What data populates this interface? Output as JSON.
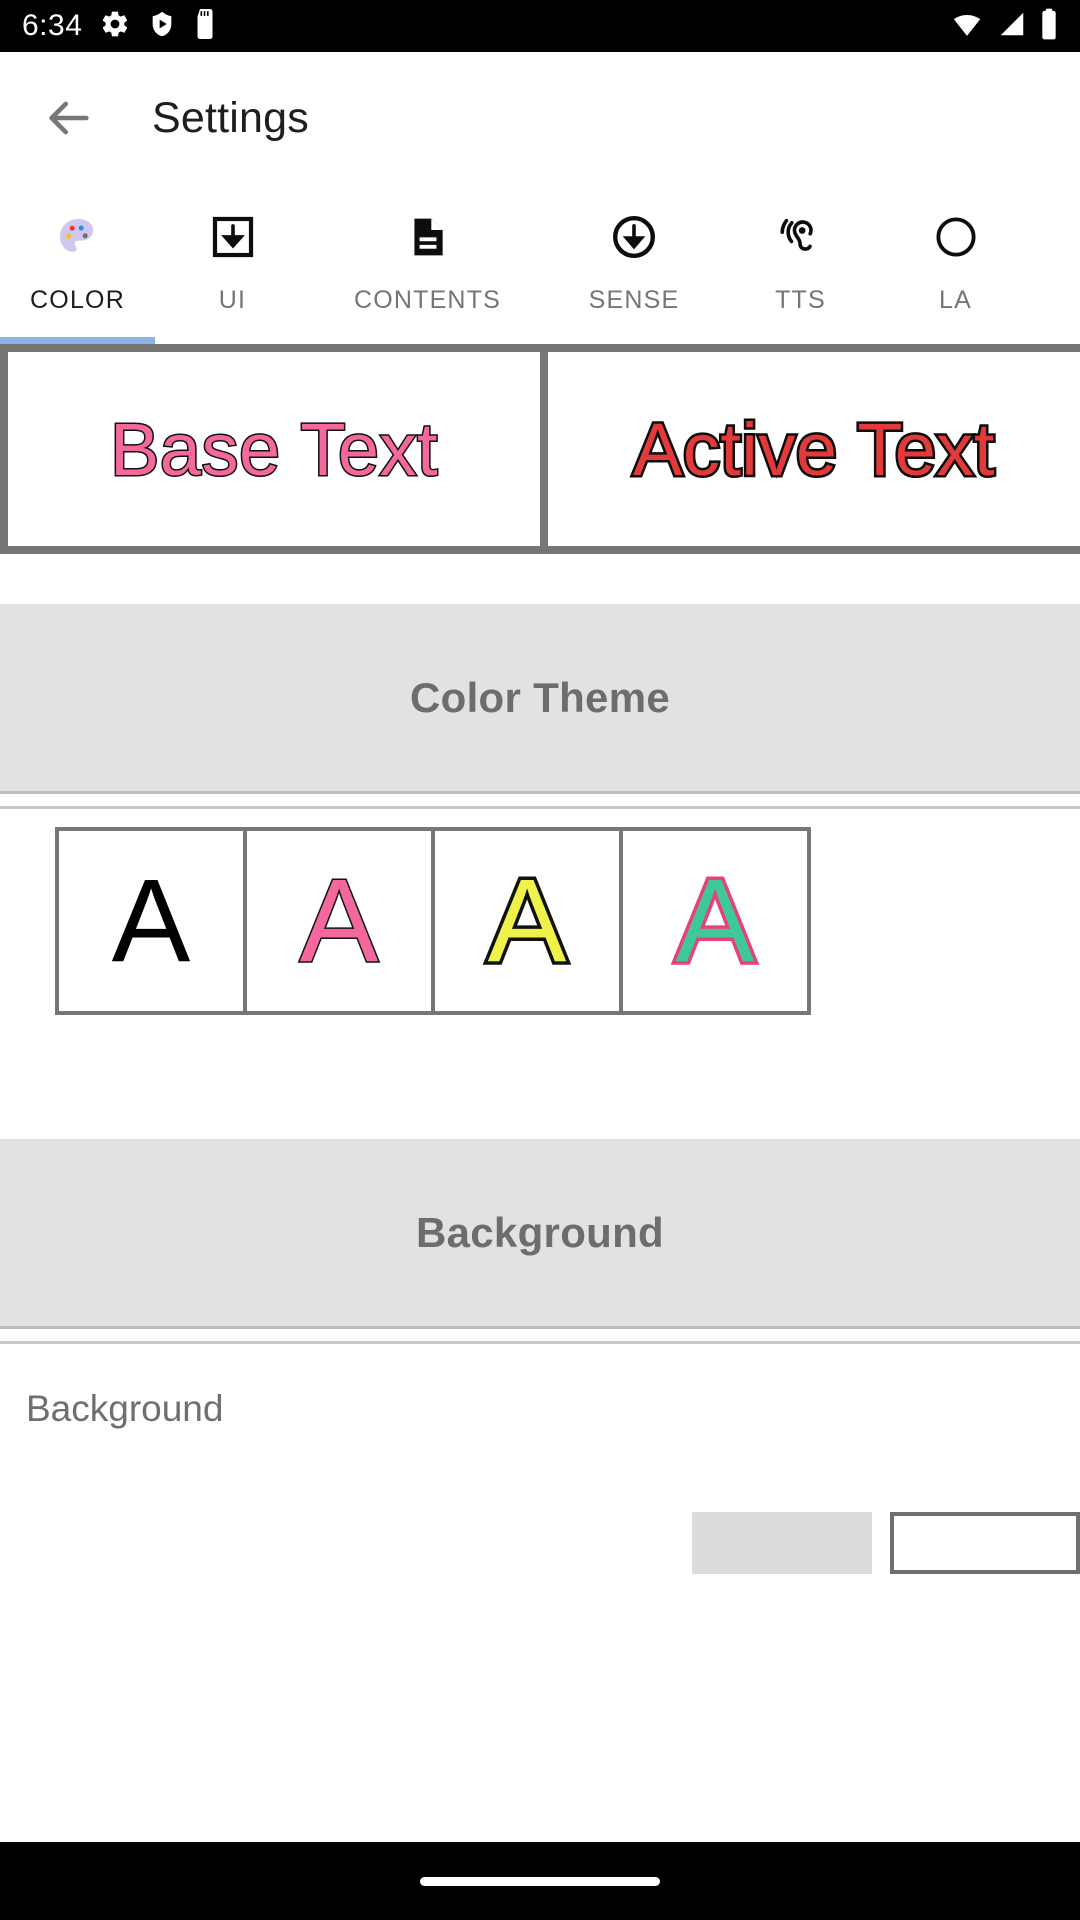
{
  "status_bar": {
    "time": "6:34",
    "left_icons": [
      "gear-icon",
      "shield-play-icon",
      "sd-card-icon"
    ],
    "right_icons": [
      "wifi-icon",
      "cell-signal-icon",
      "battery-icon"
    ],
    "background": "#000000",
    "foreground": "#ffffff"
  },
  "toolbar": {
    "back_icon": "back-arrow-icon",
    "title": "Settings"
  },
  "tabs": {
    "active_index": 0,
    "indicator_color": "#8cb4e4",
    "items": [
      {
        "label": "COLOR",
        "icon": "palette-icon"
      },
      {
        "label": "UI",
        "icon": "download-box-icon"
      },
      {
        "label": "CONTENTS",
        "icon": "document-icon"
      },
      {
        "label": "SENSE",
        "icon": "circle-down-arrow-icon"
      },
      {
        "label": "TTS",
        "icon": "hearing-ear-icon"
      },
      {
        "label": "LA",
        "icon": "language-icon"
      }
    ]
  },
  "preview": {
    "base": {
      "text": "Base Text",
      "color": "#f4689e",
      "outline": "#111111"
    },
    "active": {
      "text": "Active Text",
      "color": "#e23a3a",
      "outline": "#0d0d0d"
    }
  },
  "color_theme": {
    "header": "Color Theme",
    "swatches": [
      {
        "glyph": "A",
        "name": "theme-black",
        "fill": "#000000",
        "outline": "#000000"
      },
      {
        "glyph": "A",
        "name": "theme-pink",
        "fill": "#f4689e",
        "outline": "#111111"
      },
      {
        "glyph": "A",
        "name": "theme-yellow",
        "fill": "#eef24a",
        "outline": "#111111"
      },
      {
        "glyph": "A",
        "name": "theme-green",
        "fill": "#3fc99a",
        "outline": "#e8417a"
      }
    ]
  },
  "background_section": {
    "header": "Background",
    "row_label": "Background"
  },
  "nav_bar": {
    "gesture_pill": "home-gesture-pill"
  }
}
